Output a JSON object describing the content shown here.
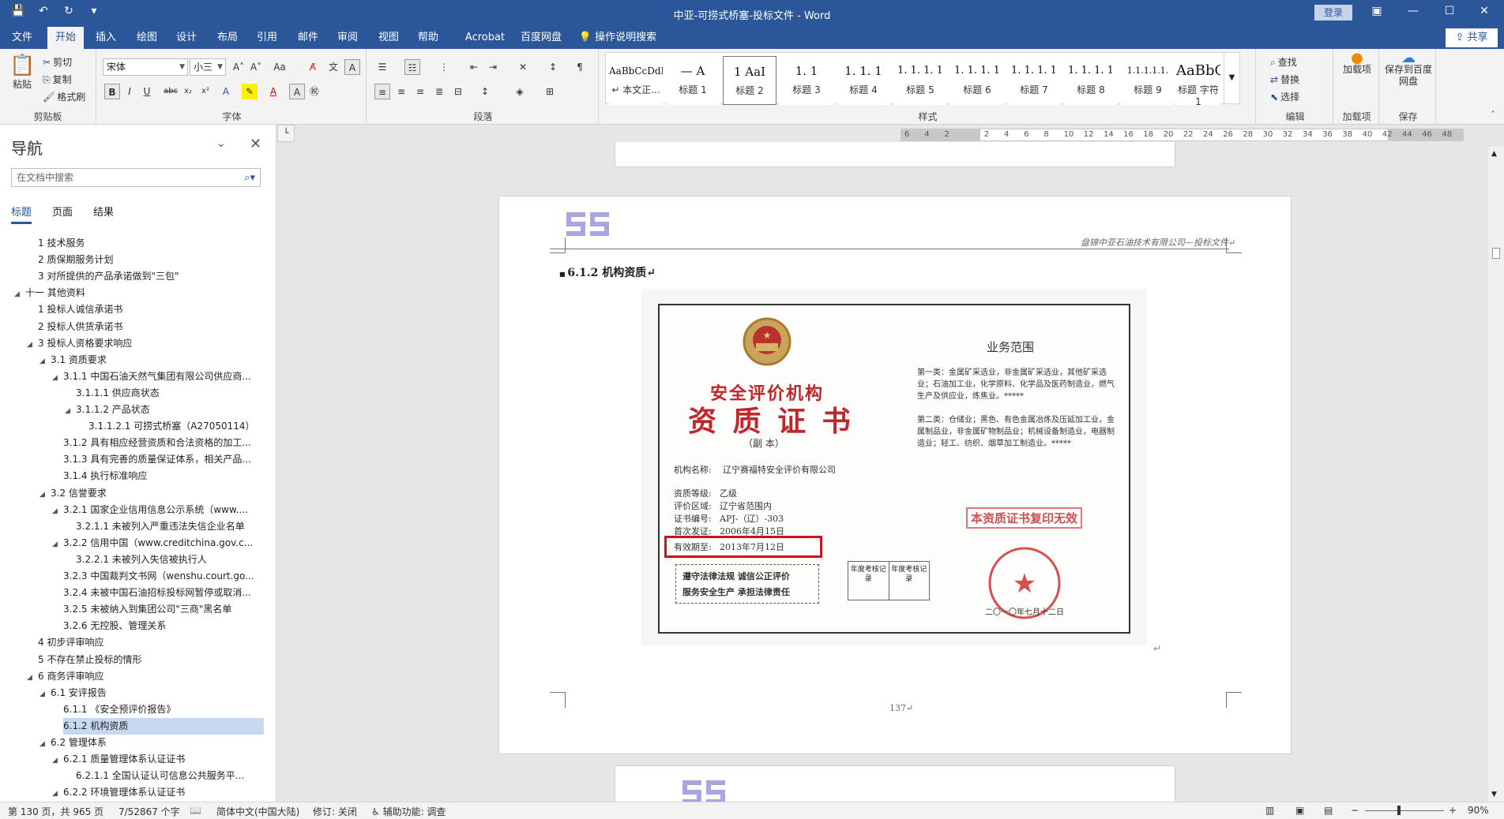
{
  "app": {
    "title": "中亚-可捞式桥塞-投标文件  -  Word",
    "login_label": "登录",
    "share_label": "共享"
  },
  "menu": {
    "tabs": [
      "文件",
      "开始",
      "插入",
      "绘图",
      "设计",
      "布局",
      "引用",
      "邮件",
      "审阅",
      "视图",
      "帮助",
      "Acrobat",
      "百度网盘",
      "操作说明搜索"
    ]
  },
  "ribbon": {
    "clipboard": {
      "paste": "粘贴",
      "cut": "剪切",
      "copy": "复制",
      "format_painter": "格式刷",
      "label": "剪贴板"
    },
    "font": {
      "name": "宋体",
      "size": "小三",
      "label": "字体"
    },
    "paragraph": {
      "label": "段落"
    },
    "styles": {
      "label": "样式",
      "items": [
        {
          "sample": "AaBbCcDdI",
          "name": "↵ 本文正..."
        },
        {
          "sample": "—  A",
          "name": "标题 1"
        },
        {
          "sample": "1  AaI",
          "name": "标题 2"
        },
        {
          "sample": "1. 1",
          "name": "标题 3"
        },
        {
          "sample": "1. 1. 1",
          "name": "标题 4"
        },
        {
          "sample": "1. 1. 1. 1",
          "name": "标题 5"
        },
        {
          "sample": "1. 1. 1. 1",
          "name": "标题 6"
        },
        {
          "sample": "1. 1. 1. 1",
          "name": "标题 7"
        },
        {
          "sample": "1. 1. 1. 1",
          "name": "标题 8"
        },
        {
          "sample": "1.1.1.1.1.",
          "name": "标题 9"
        },
        {
          "sample": "AaBbC",
          "name": "标题 字符1"
        }
      ]
    },
    "editing": {
      "find": "查找",
      "replace": "替换",
      "select": "选择",
      "label": "编辑"
    },
    "addins": {
      "load": "加载项",
      "label": "加载项"
    },
    "save": {
      "save_to": "保存到百度网盘",
      "label": "保存"
    }
  },
  "nav": {
    "title": "导航",
    "search_placeholder": "在文档中搜索",
    "tabs": [
      "标题",
      "页面",
      "结果"
    ],
    "items": [
      {
        "label": "1 技术服务",
        "level": 2,
        "arrow": ""
      },
      {
        "label": "2 质保期服务计划",
        "level": 2,
        "arrow": ""
      },
      {
        "label": "3 对所提供的产品承诺做到\"三包\"",
        "level": 2,
        "arrow": ""
      },
      {
        "label": "十一 其他资料",
        "level": 1,
        "arrow": "◢"
      },
      {
        "label": "1 投标人诚信承诺书",
        "level": 2,
        "arrow": ""
      },
      {
        "label": "2 投标人供货承诺书",
        "level": 2,
        "arrow": ""
      },
      {
        "label": "3 投标人资格要求响应",
        "level": 2,
        "arrow": "◢"
      },
      {
        "label": "3.1 资质要求",
        "level": 3,
        "arrow": "◢"
      },
      {
        "label": "3.1.1 中国石油天然气集团有限公司供应商...",
        "level": 4,
        "arrow": "◢"
      },
      {
        "label": "3.1.1.1 供应商状态",
        "level": 5,
        "arrow": ""
      },
      {
        "label": "3.1.1.2 产品状态",
        "level": 5,
        "arrow": "◢"
      },
      {
        "label": "3.1.1.2.1 可捞式桥塞（A27050114）",
        "level": 6,
        "arrow": ""
      },
      {
        "label": "3.1.2 具有相应经营资质和合法资格的加工...",
        "level": 4,
        "arrow": ""
      },
      {
        "label": "3.1.3 具有完善的质量保证体系，相关产品...",
        "level": 4,
        "arrow": ""
      },
      {
        "label": "3.1.4 执行标准响应",
        "level": 4,
        "arrow": ""
      },
      {
        "label": "3.2 信誉要求",
        "level": 3,
        "arrow": "◢"
      },
      {
        "label": "3.2.1 国家企业信用信息公示系统（www....",
        "level": 4,
        "arrow": "◢"
      },
      {
        "label": "3.2.1.1 未被列入严重违法失信企业名单",
        "level": 5,
        "arrow": ""
      },
      {
        "label": "3.2.2 信用中国（www.creditchina.gov.c...",
        "level": 4,
        "arrow": "◢"
      },
      {
        "label": "3.2.2.1 未被列入失信被执行人",
        "level": 5,
        "arrow": ""
      },
      {
        "label": "3.2.3 中国裁判文书网（wenshu.court.go...",
        "level": 4,
        "arrow": ""
      },
      {
        "label": "3.2.4 未被中国石油招标投标网暂停或取消...",
        "level": 4,
        "arrow": ""
      },
      {
        "label": "3.2.5 未被纳入到集团公司\"三商\"黑名单",
        "level": 4,
        "arrow": ""
      },
      {
        "label": "3.2.6 无控股、管理关系",
        "level": 4,
        "arrow": ""
      },
      {
        "label": "4 初步评审响应",
        "level": 2,
        "arrow": ""
      },
      {
        "label": "5 不存在禁止投标的情形",
        "level": 2,
        "arrow": ""
      },
      {
        "label": "6 商务评审响应",
        "level": 2,
        "arrow": "◢"
      },
      {
        "label": "6.1 安评报告",
        "level": 3,
        "arrow": "◢"
      },
      {
        "label": "6.1.1 《安全预评价报告》",
        "level": 4,
        "arrow": ""
      },
      {
        "label": "6.1.2 机构资质",
        "level": 4,
        "arrow": "",
        "highlight": true
      },
      {
        "label": "6.2 管理体系",
        "level": 3,
        "arrow": "◢"
      },
      {
        "label": "6.2.1 质量管理体系认证证书",
        "level": 4,
        "arrow": "◢"
      },
      {
        "label": "6.2.1.1 全国认证认可信息公共服务平...",
        "level": 5,
        "arrow": ""
      },
      {
        "label": "6.2.2 环境管理体系认证证书",
        "level": 4,
        "arrow": "◢"
      }
    ]
  },
  "ruler": {
    "ticks": [
      "6",
      "4",
      "2",
      "",
      "2",
      "4",
      "6",
      "8",
      "10",
      "12",
      "14",
      "16",
      "18",
      "20",
      "22",
      "24",
      "26",
      "28",
      "30",
      "32",
      "34",
      "36",
      "38",
      "40",
      "42",
      "44",
      "46",
      "48"
    ]
  },
  "document": {
    "header_text": "盘锦中亚石油技术有限公司—投标文件↵",
    "heading": "6.1.2 机构资质↵",
    "page_number": "137↵",
    "return_mark": "↵",
    "cert": {
      "org_type": "安全评价机构",
      "cert_title": "资 质 证 书",
      "copy_label": "（副  本）",
      "fields": [
        {
          "label": "机构名称:",
          "value": "辽宁赛福特安全评价有限公司"
        },
        {
          "label": "资质等级:",
          "value": "乙级"
        },
        {
          "label": "评价区域:",
          "value": "辽宁省范围内"
        },
        {
          "label": "证书编号:",
          "value": "APJ-（辽）-303"
        },
        {
          "label": "首次发证:",
          "value": "2006年4月15日"
        },
        {
          "label": "有效期至:",
          "value": "2013年7月12日"
        }
      ],
      "scope_title": "业务范围",
      "scope_1": "第一类：金属矿采选业，非金属矿采选业，其他矿采选业；石油加工业，化学原料、化学品及医药制造业，燃气生产及供应业，炼焦业。*****",
      "scope_2": "第二类：仓储业；黑色、有色金属冶炼及压延加工业，金属制品业，非金属矿物制品业；机械设备制造业，电器制造业；轻工、纺织、烟草加工制造业。*****",
      "stamp_copy_invalid": "本资质证书复印无效",
      "motto_1": "遵守法律法规  诚信公正评价",
      "motto_2": "服务安全生产  承担法律责任",
      "annual_1": "年度考核记录",
      "annual_2": "年度考核记录",
      "issue_date": "二〇一〇年七月十二日",
      "seal_text": "辽宁省安全生产监督管理局"
    }
  },
  "status": {
    "page": "第 130 页，共 965 页",
    "words": "7/52867 个字",
    "language": "简体中文(中国大陆)",
    "track": "修订: 关闭",
    "accessibility": "辅助功能: 调查",
    "zoom": "90%",
    "zoom_level": 0.9
  }
}
